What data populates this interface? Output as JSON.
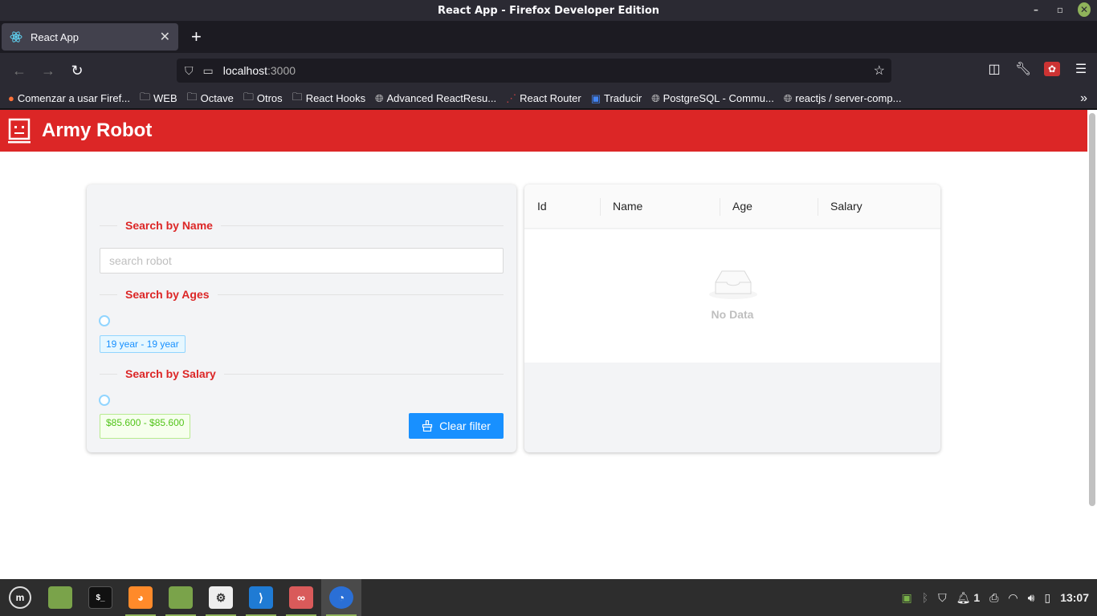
{
  "window": {
    "title": "React App - Firefox Developer Edition"
  },
  "browser": {
    "tab_title": "React App",
    "url_host": "localhost",
    "url_port": ":3000",
    "bookmarks": [
      {
        "label": "Comenzar a usar Firef...",
        "icon": "firefox-icon"
      },
      {
        "label": "WEB",
        "icon": "folder-icon"
      },
      {
        "label": "Octave",
        "icon": "folder-icon"
      },
      {
        "label": "Otros",
        "icon": "folder-icon"
      },
      {
        "label": "React Hooks",
        "icon": "folder-icon"
      },
      {
        "label": "Advanced ReactResu...",
        "icon": "globe-icon"
      },
      {
        "label": "React Router",
        "icon": "react-router-icon"
      },
      {
        "label": "Traducir",
        "icon": "translate-icon"
      },
      {
        "label": "PostgreSQL - Commu...",
        "icon": "globe-icon"
      },
      {
        "label": "reactjs / server-comp...",
        "icon": "globe-icon"
      }
    ]
  },
  "app": {
    "title": "Army Robot",
    "accent": "#dc2626",
    "filters": {
      "name_heading": "Search by Name",
      "name_placeholder": "search robot",
      "name_value": "",
      "ages_heading": "Search by Ages",
      "ages_tag": "19 year - 19 year",
      "salary_heading": "Search by Salary",
      "salary_tag": "$85.600 - $85.600",
      "clear_label": "Clear filter"
    },
    "table": {
      "columns": [
        "Id",
        "Name",
        "Age",
        "Salary"
      ],
      "rows": [],
      "empty_text": "No Data"
    }
  },
  "taskbar": {
    "apps": [
      "mint-menu-icon",
      "files-icon",
      "terminal-icon",
      "firefox-orange-icon",
      "folder-icon",
      "settings-icon",
      "vscode-icon",
      "glasses-icon",
      "firefox-dev-icon"
    ],
    "notification_count": "1",
    "clock": "13:07"
  }
}
